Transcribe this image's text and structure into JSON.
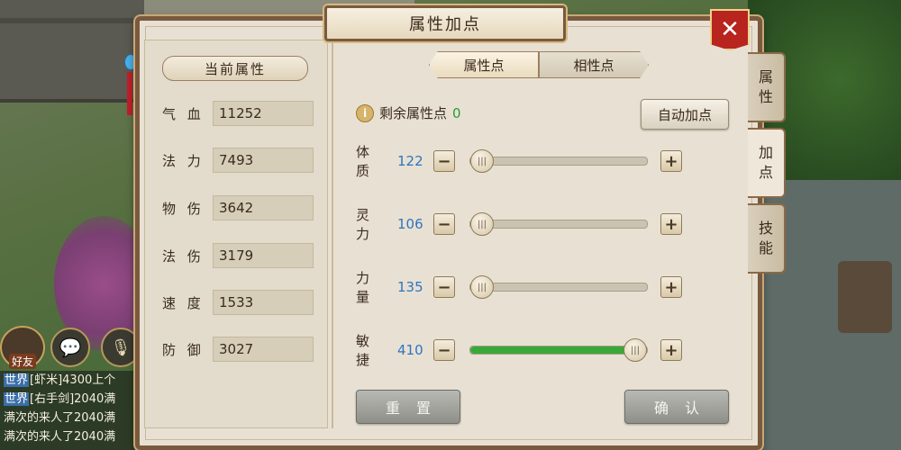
{
  "window": {
    "title": "属性加点",
    "close_label": "✕"
  },
  "side_tabs": [
    {
      "label_1": "属",
      "label_2": "性"
    },
    {
      "label_1": "加",
      "label_2": "点"
    },
    {
      "label_1": "技",
      "label_2": "能"
    }
  ],
  "left": {
    "header": "当前属性",
    "attrs": [
      {
        "label": "气 血",
        "value": "11252"
      },
      {
        "label": "法 力",
        "value": "7493"
      },
      {
        "label": "物 伤",
        "value": "3642"
      },
      {
        "label": "法 伤",
        "value": "3179"
      },
      {
        "label": "速 度",
        "value": "1533"
      },
      {
        "label": "防 御",
        "value": "3027"
      }
    ]
  },
  "tabs": [
    {
      "label": "属性点",
      "active": true
    },
    {
      "label": "相性点",
      "active": false
    }
  ],
  "remaining": {
    "label": "剩余属性点",
    "value": "0"
  },
  "auto_button": "自动加点",
  "sliders": [
    {
      "name": "体 质",
      "value": "122",
      "fraction": 0.0
    },
    {
      "name": "灵 力",
      "value": "106",
      "fraction": 0.0
    },
    {
      "name": "力 量",
      "value": "135",
      "fraction": 0.0
    },
    {
      "name": "敏 捷",
      "value": "410",
      "fraction": 1.0
    }
  ],
  "buttons": {
    "minus": "−",
    "plus": "+",
    "knob": "|||"
  },
  "reset_button": "重置",
  "confirm_button": "确认",
  "hud": {
    "friend_label": "好友",
    "chat_icon": "chat-bubble-icon",
    "voice_icon": "microphone-icon",
    "chat_lines": [
      {
        "tag": "世界",
        "text": "[虾米]4300上个"
      },
      {
        "tag": "世界",
        "text": "[右手剑]2040满"
      },
      {
        "tag": "",
        "text": "满次的来人了2040满"
      },
      {
        "tag": "",
        "text": "满次的来人了2040满"
      }
    ]
  },
  "colors": {
    "frame": "#7a5a3e",
    "panel": "#e8e1d3",
    "value_blue": "#2f74c0",
    "remaining_green": "#2e9a2e",
    "slider_fill": "#39a83a",
    "close_red": "#b8241e"
  }
}
